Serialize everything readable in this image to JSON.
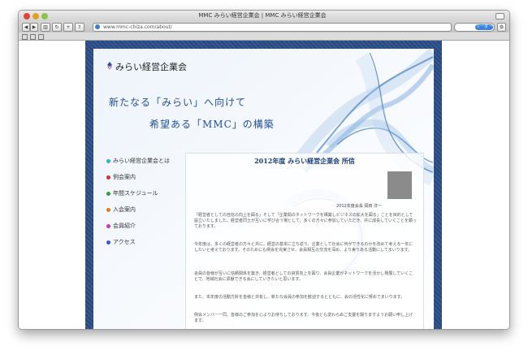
{
  "window": {
    "title": "MMC みらい経営企業会 | MMC みらい経営企業会"
  },
  "toolbar": {
    "url": "www.mmc-chiza.com/about/",
    "search_button": "リーダー"
  },
  "site": {
    "logo_text": "みらい経営企業会",
    "hero_line1": "新たなる「みらい」へ向けて",
    "hero_line2": "希望ある「MMC」の構築"
  },
  "nav": {
    "items": [
      {
        "label": "みらい経営企業会とは",
        "color": "#2bb3c6"
      },
      {
        "label": "例会案内",
        "color": "#d2322d"
      },
      {
        "label": "年間スケジュール",
        "color": "#2a9d3f"
      },
      {
        "label": "入会案内",
        "color": "#e07a1f"
      },
      {
        "label": "会員紹介",
        "color": "#c23bb8"
      },
      {
        "label": "アクセス",
        "color": "#3a5bd0"
      }
    ]
  },
  "article": {
    "title": "2012年度 みらい経営企業会 所信",
    "caption": "2012年度会長 岡田 淳一",
    "paragraphs": [
      "「経営者としての自信の向上を図る」そして「企業間のネットワークを構築しビジネスの拡大を図る」ことを目的として設立いたしました。経営者同士が互いに学び合う場として、多くの方々に参加していただき、共に成長していくことを願っております。",
      "今年度は、多くの経営者の方々と共に、経営の基本に立ち返り、企業として社会に何ができるのかを改めて考える一年にしたいと考えております。そのためにも例会を充実させ、会員相互の交流を深め、より実りある活動にしてまいります。",
      "会員の皆様が互いに信頼関係を築き、経営者としての資質向上を図り、会員企業がネットワークを活かし発展していくことで、地域社会に貢献できる会にしていきたいと思います。",
      "また、本年度の活動方針を皆様と共有し、新たな会員の参加を歓迎するとともに、会の活性化に努めてまいります。",
      "例会メンバー一同、皆様のご参加を心よりお待ちしております。今後とも変わらぬご支援を賜りますようお願い申し上げます。"
    ]
  },
  "colors": {
    "frame": "#27477e",
    "heading": "#1f4f98",
    "panel_title": "#1f3f7a"
  }
}
